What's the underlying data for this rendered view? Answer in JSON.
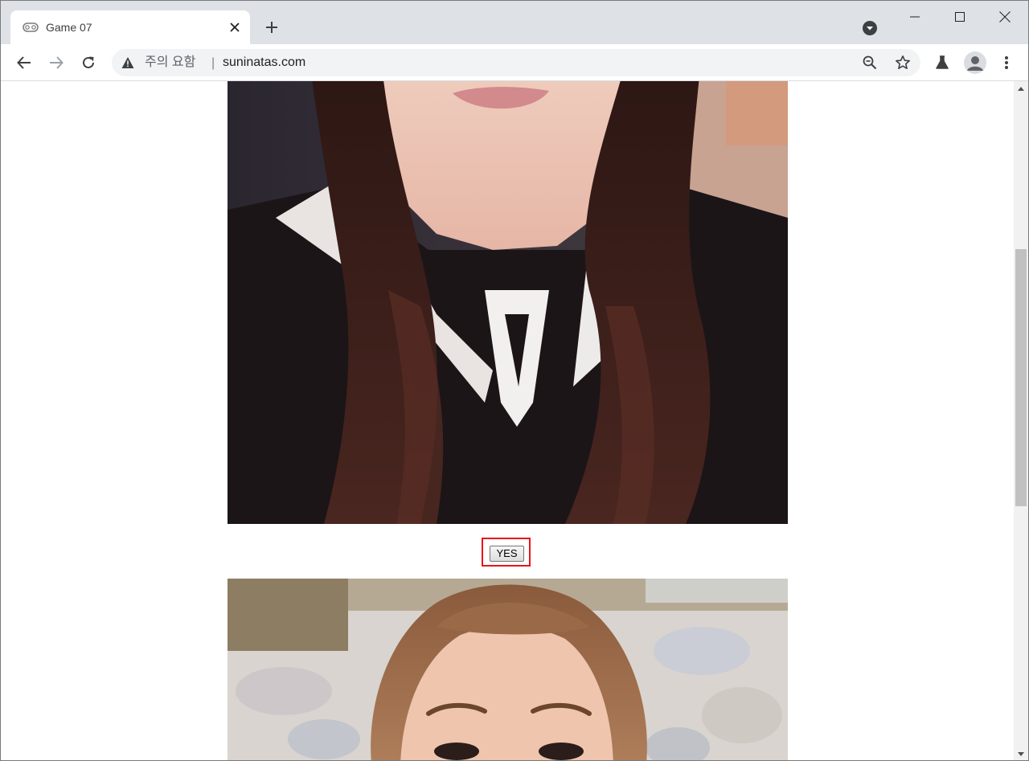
{
  "tab": {
    "title": "Game 07",
    "favicon": "gamepad-icon"
  },
  "omnibox": {
    "security_label": "주의 요함",
    "separator": "|",
    "url": "suninatas.com"
  },
  "page": {
    "yes_button_label": "YES",
    "highlight_color": "#e8141b"
  },
  "colors": {
    "tabstrip_bg": "#dee1e6",
    "omnibox_bg": "#f1f3f4"
  },
  "icons": [
    "gamepad-icon",
    "close-icon",
    "plus-icon",
    "tab-search-icon",
    "minimize-icon",
    "maximize-icon",
    "window-close-icon",
    "back-arrow-icon",
    "forward-arrow-icon",
    "reload-icon",
    "warning-icon",
    "zoom-icon",
    "star-icon",
    "labs-flask-icon",
    "profile-icon",
    "kebab-menu-icon"
  ]
}
